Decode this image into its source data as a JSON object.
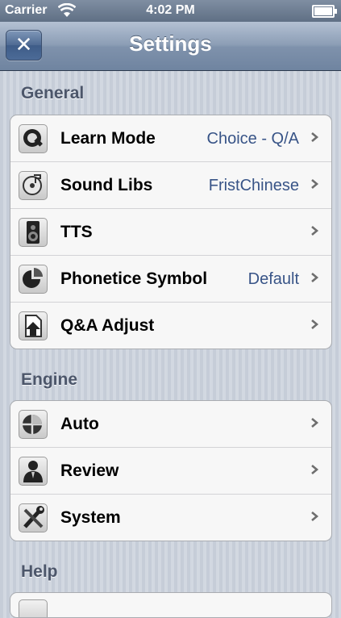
{
  "status_bar": {
    "carrier": "Carrier",
    "time": "4:02 PM"
  },
  "nav": {
    "title": "Settings",
    "close_label": "✕"
  },
  "sections": [
    {
      "header": "General",
      "rows": [
        {
          "label": "Learn Mode",
          "value": "Choice - Q/A",
          "icon": "quicktime-icon"
        },
        {
          "label": "Sound Libs",
          "value": "FristChinese",
          "icon": "music-disc-icon"
        },
        {
          "label": "TTS",
          "value": "",
          "icon": "speaker-icon"
        },
        {
          "label": "Phonetice Symbol",
          "value": "Default",
          "icon": "pie-chart-icon"
        },
        {
          "label": "Q&A Adjust",
          "value": "",
          "icon": "document-arrow-icon"
        }
      ]
    },
    {
      "header": "Engine",
      "rows": [
        {
          "label": "Auto",
          "value": "",
          "icon": "globe-icon"
        },
        {
          "label": "Review",
          "value": "",
          "icon": "person-icon"
        },
        {
          "label": "System",
          "value": "",
          "icon": "tools-icon"
        }
      ]
    },
    {
      "header": "Help",
      "rows": []
    }
  ],
  "colors": {
    "value_text": "#385487",
    "nav_bar": "#7f92ac",
    "section_header": "#4c566a"
  }
}
